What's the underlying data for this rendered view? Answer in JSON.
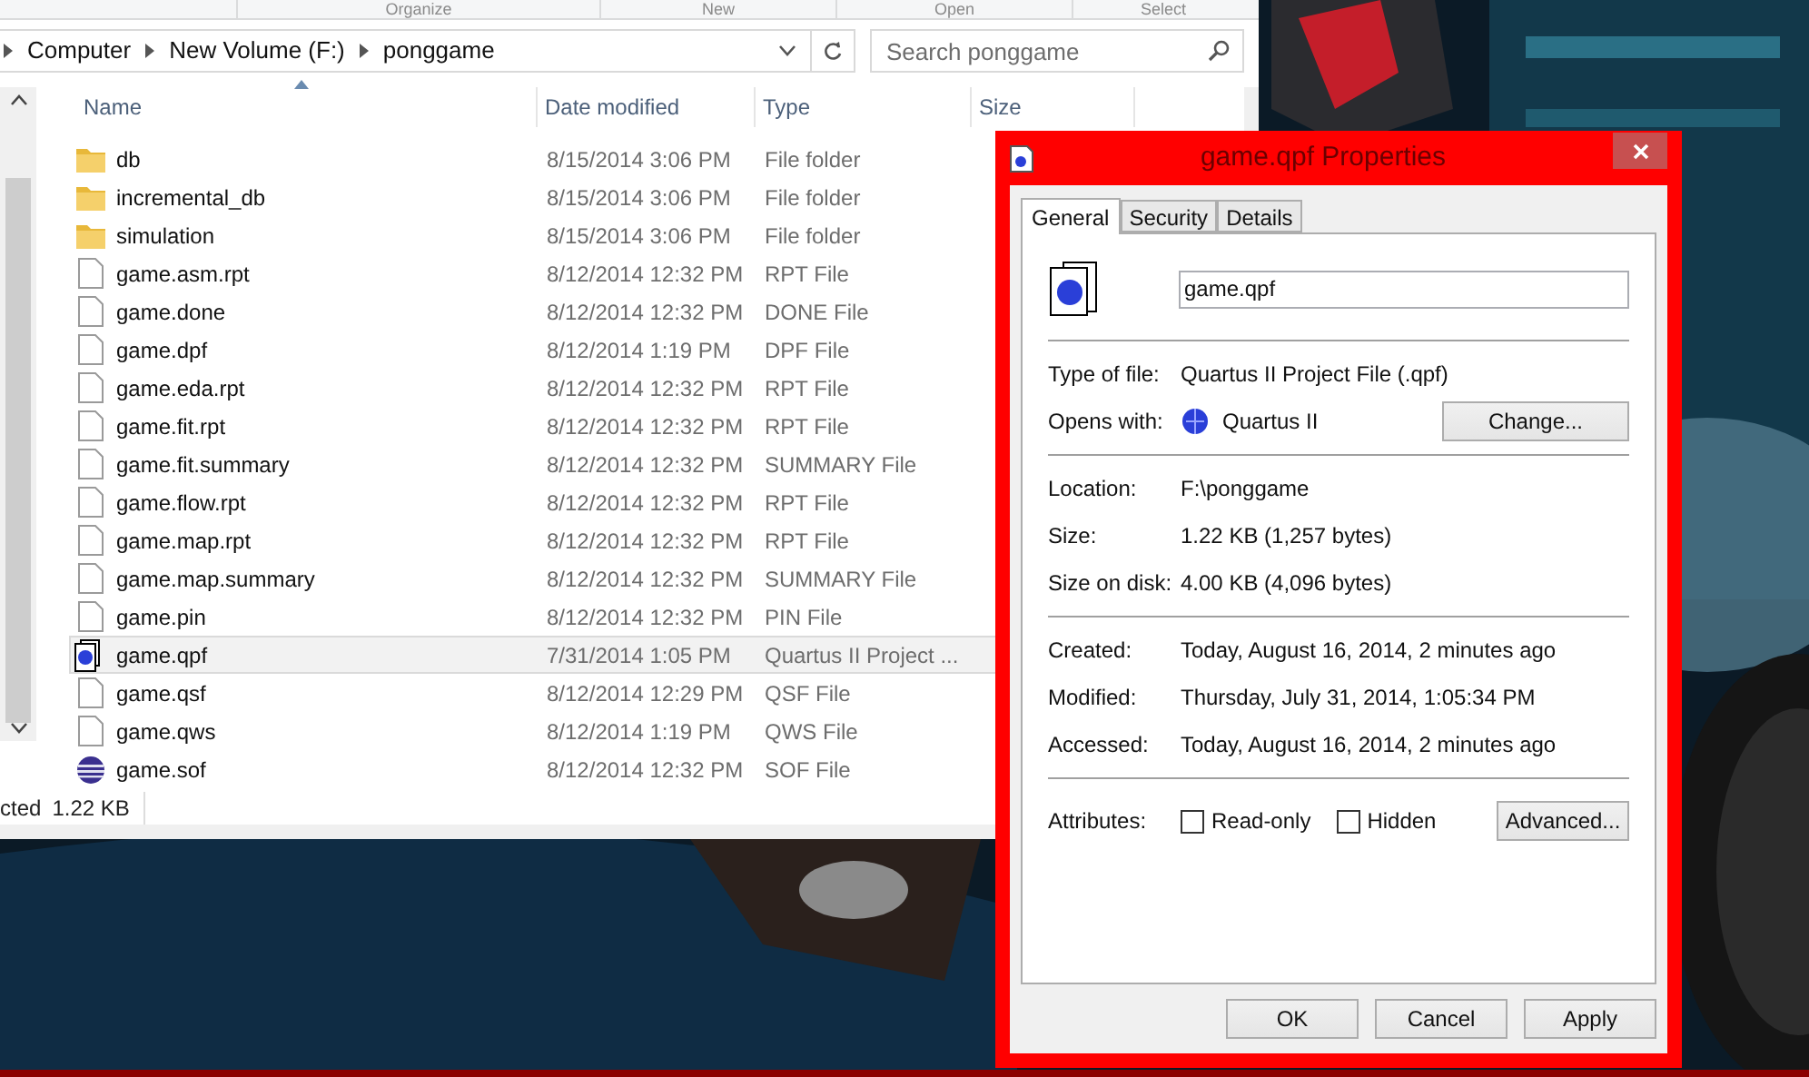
{
  "toolbar_groups": [
    "Organize",
    "New",
    "Open",
    "Select"
  ],
  "address_bar": {
    "breadcrumbs": [
      "Computer",
      "New Volume (F:)",
      "ponggame"
    ]
  },
  "search": {
    "placeholder": "Search ponggame"
  },
  "columns": [
    "Name",
    "Date modified",
    "Type",
    "Size"
  ],
  "files": [
    {
      "name": "db",
      "date": "8/15/2014 3:06 PM",
      "type": "File folder",
      "kind": "folder",
      "selected": false
    },
    {
      "name": "incremental_db",
      "date": "8/15/2014 3:06 PM",
      "type": "File folder",
      "kind": "folder",
      "selected": false
    },
    {
      "name": "simulation",
      "date": "8/15/2014 3:06 PM",
      "type": "File folder",
      "kind": "folder",
      "selected": false
    },
    {
      "name": "game.asm.rpt",
      "date": "8/12/2014 12:32 PM",
      "type": "RPT File",
      "kind": "file",
      "selected": false
    },
    {
      "name": "game.done",
      "date": "8/12/2014 12:32 PM",
      "type": "DONE File",
      "kind": "file",
      "selected": false
    },
    {
      "name": "game.dpf",
      "date": "8/12/2014 1:19 PM",
      "type": "DPF File",
      "kind": "file",
      "selected": false
    },
    {
      "name": "game.eda.rpt",
      "date": "8/12/2014 12:32 PM",
      "type": "RPT File",
      "kind": "file",
      "selected": false
    },
    {
      "name": "game.fit.rpt",
      "date": "8/12/2014 12:32 PM",
      "type": "RPT File",
      "kind": "file",
      "selected": false
    },
    {
      "name": "game.fit.summary",
      "date": "8/12/2014 12:32 PM",
      "type": "SUMMARY File",
      "kind": "file",
      "selected": false
    },
    {
      "name": "game.flow.rpt",
      "date": "8/12/2014 12:32 PM",
      "type": "RPT File",
      "kind": "file",
      "selected": false
    },
    {
      "name": "game.map.rpt",
      "date": "8/12/2014 12:32 PM",
      "type": "RPT File",
      "kind": "file",
      "selected": false
    },
    {
      "name": "game.map.summary",
      "date": "8/12/2014 12:32 PM",
      "type": "SUMMARY File",
      "kind": "file",
      "selected": false
    },
    {
      "name": "game.pin",
      "date": "8/12/2014 12:32 PM",
      "type": "PIN File",
      "kind": "file",
      "selected": false
    },
    {
      "name": "game.qpf",
      "date": "7/31/2014 1:05 PM",
      "type": "Quartus II Project ...",
      "kind": "qpf",
      "selected": true
    },
    {
      "name": "game.qsf",
      "date": "8/12/2014 12:29 PM",
      "type": "QSF File",
      "kind": "file",
      "selected": false
    },
    {
      "name": "game.qws",
      "date": "8/12/2014 1:19 PM",
      "type": "QWS File",
      "kind": "file",
      "selected": false
    },
    {
      "name": "game.sof",
      "date": "8/12/2014 12:32 PM",
      "type": "SOF File",
      "kind": "sof",
      "selected": false
    }
  ],
  "status_bar": {
    "selection": "cted",
    "size": "1.22 KB"
  },
  "dialog": {
    "title": "game.qpf Properties",
    "tabs": [
      {
        "label": "General",
        "selected": true
      },
      {
        "label": "Security",
        "selected": false
      },
      {
        "label": "Details",
        "selected": false
      }
    ],
    "filename": "game.qpf",
    "sections": [
      [
        {
          "label": "Type of file:",
          "value": "Quartus II Project File (.qpf)",
          "kind": "text"
        },
        {
          "label": "Opens with:",
          "value": "Quartus II",
          "kind": "app",
          "button": "Change..."
        }
      ],
      [
        {
          "label": "Location:",
          "value": "F:\\ponggame",
          "kind": "text"
        },
        {
          "label": "Size:",
          "value": "1.22 KB (1,257 bytes)",
          "kind": "text"
        },
        {
          "label": "Size on disk:",
          "value": "4.00 KB (4,096 bytes)",
          "kind": "text"
        }
      ],
      [
        {
          "label": "Created:",
          "value": "Today, August 16, 2014, 2 minutes ago",
          "kind": "text"
        },
        {
          "label": "Modified:",
          "value": "Thursday, July 31, 2014, 1:05:34 PM",
          "kind": "text"
        },
        {
          "label": "Accessed:",
          "value": "Today, August 16, 2014, 2 minutes ago",
          "kind": "text"
        }
      ]
    ],
    "attributes": {
      "label": "Attributes:",
      "options": [
        {
          "label": "Read-only",
          "checked": false
        },
        {
          "label": "Hidden",
          "checked": false
        }
      ],
      "button": "Advanced..."
    },
    "buttons": [
      "OK",
      "Cancel",
      "Apply"
    ]
  }
}
